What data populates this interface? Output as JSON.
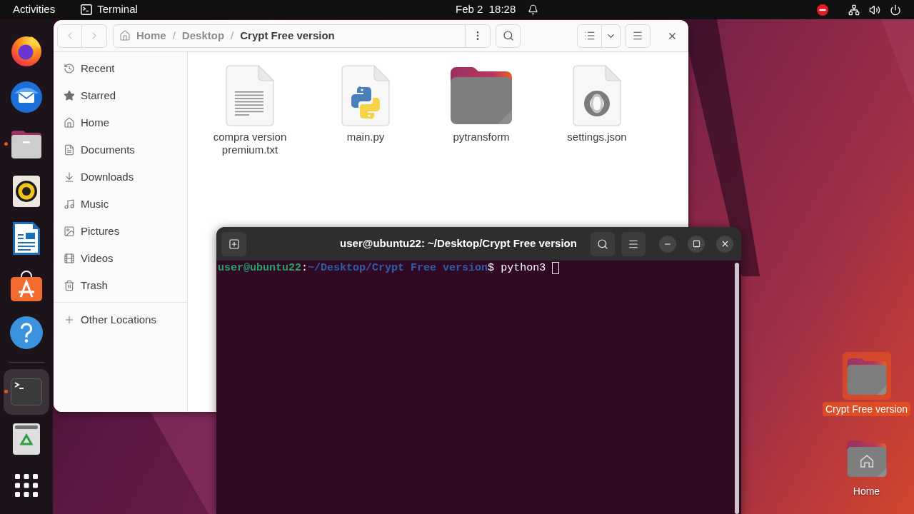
{
  "top_bar": {
    "activities": "Activities",
    "app_name": "Terminal",
    "clock": "Feb 2  18:28"
  },
  "dock": {
    "favorites": [
      {
        "kind": "browser",
        "running": false,
        "selected": false
      },
      {
        "kind": "mail",
        "running": false,
        "selected": false
      },
      {
        "kind": "files",
        "running": true,
        "selected": false
      },
      {
        "kind": "music",
        "running": false,
        "selected": false
      },
      {
        "kind": "writer",
        "running": false,
        "selected": false
      },
      {
        "kind": "store",
        "running": false,
        "selected": false
      },
      {
        "kind": "help",
        "running": false,
        "selected": false
      }
    ],
    "others": [
      {
        "kind": "terminal",
        "running": true,
        "selected": true
      },
      {
        "kind": "trash",
        "running": false,
        "selected": false
      }
    ]
  },
  "file_manager": {
    "nav_buttons": [
      {
        "kind": "back",
        "disabled": true
      },
      {
        "kind": "forward",
        "disabled": true
      }
    ],
    "path": [
      {
        "label": "Home",
        "selected": false
      },
      {
        "separator": "/",
        "label": "Desktop",
        "selected": false
      },
      {
        "separator": "/",
        "label": "Crypt Free version",
        "selected": true
      }
    ],
    "sidebar": {
      "items": [
        {
          "kind": "recent",
          "label": "Recent",
          "selected": false
        },
        {
          "kind": "starred",
          "label": "Starred",
          "selected": false
        },
        {
          "kind": "home",
          "label": "Home",
          "selected": false
        },
        {
          "kind": "documents",
          "label": "Documents",
          "selected": false
        },
        {
          "kind": "downloads",
          "label": "Downloads",
          "selected": false
        },
        {
          "kind": "music",
          "label": "Music",
          "selected": false
        },
        {
          "kind": "pictures",
          "label": "Pictures",
          "selected": false
        },
        {
          "kind": "videos",
          "label": "Videos",
          "selected": false
        },
        {
          "kind": "trash",
          "label": "Trash",
          "selected": false
        }
      ],
      "other_locations": "Other Locations"
    },
    "files": [
      {
        "name": "compra version premium.txt",
        "kind": "text",
        "selected": false
      },
      {
        "name": "main.py",
        "kind": "python",
        "selected": false
      },
      {
        "name": "pytransform",
        "kind": "folder",
        "selected": false
      },
      {
        "name": "settings.json",
        "kind": "json",
        "selected": false
      }
    ]
  },
  "terminal": {
    "title": "user@ubuntu22: ~/Desktop/Crypt Free version",
    "prompt": {
      "user_host": "user@ubuntu22",
      "separator": ":",
      "path": "~/Desktop/Crypt Free version",
      "symbol": "$",
      "command": "python3"
    }
  },
  "desktop_icons": [
    {
      "label": "Crypt Free version",
      "kind": "folder",
      "selected": true
    },
    {
      "label": "Home",
      "kind": "home",
      "selected": false
    }
  ]
}
